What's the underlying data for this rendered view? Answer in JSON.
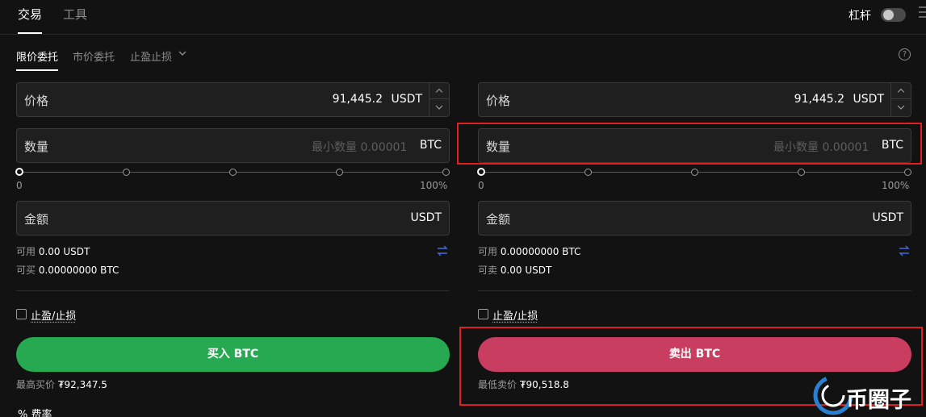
{
  "topbar": {
    "tabs": [
      "交易",
      "工具"
    ],
    "leverage_label": "杠杆"
  },
  "order_tabs": [
    "限价委托",
    "市价委托",
    "止盈止损"
  ],
  "buy": {
    "price_label": "价格",
    "price_value": "91,445.2",
    "price_unit": "USDT",
    "qty_label": "数量",
    "qty_placeholder": "最小数量 0.00001",
    "qty_unit": "BTC",
    "slider_min": "0",
    "slider_max": "100%",
    "slider_value": 0,
    "amount_label": "金额",
    "amount_unit": "USDT",
    "avail_label": "可用",
    "avail_value": "0.00 USDT",
    "can_label": "可买",
    "can_value": "0.00000000 BTC",
    "tpsl_label": "止盈/止损",
    "button_label": "买入 BTC",
    "best_label": "最高买价",
    "best_value": "₮92,347.5"
  },
  "sell": {
    "price_label": "价格",
    "price_value": "91,445.2",
    "price_unit": "USDT",
    "qty_label": "数量",
    "qty_placeholder": "最小数量 0.00001",
    "qty_unit": "BTC",
    "slider_min": "0",
    "slider_max": "100%",
    "slider_value": 0,
    "amount_label": "金额",
    "amount_unit": "USDT",
    "avail_label": "可用",
    "avail_value": "0.00000000 BTC",
    "can_label": "可卖",
    "can_value": "0.00 USDT",
    "tpsl_label": "止盈/止损",
    "button_label": "卖出 BTC",
    "best_label": "最低卖价",
    "best_value": "₮90,518.8"
  },
  "fee": {
    "icon": "%",
    "label": "费率"
  },
  "watermark": {
    "text": "币圈子"
  },
  "colors": {
    "buy": "#27a951",
    "sell": "#c93d60",
    "highlight": "#e02020",
    "swap": "#3d6ee6"
  }
}
